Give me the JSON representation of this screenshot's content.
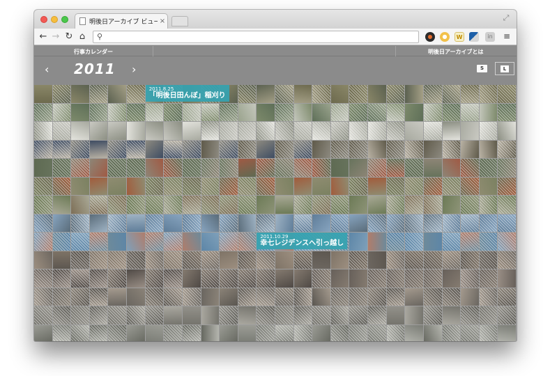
{
  "browser": {
    "tab_title": "明後日アーカイブ ビューワ",
    "tab_close": "×",
    "omnibox_value": "",
    "ext_3_label": "W",
    "ext_5_label": "in"
  },
  "site": {
    "nav_left": "行事カレンダー",
    "nav_right": "明後日アーカイブとは"
  },
  "calendar": {
    "year": "2011",
    "prev_symbol": "‹",
    "next_symbol": "›",
    "size_small": "S",
    "size_large": "L"
  },
  "events": [
    {
      "date": "2011.8.25",
      "title": "「明後日田んぼ」稲刈り"
    },
    {
      "date": "2011.10.29",
      "title": "幸七レジデンスへ引っ越し"
    }
  ],
  "mosaic": {
    "rows": 14,
    "columns": 26,
    "row_palettes": [
      [
        "#6d6a4e",
        "#8a8768",
        "#5b6150",
        "#a49f86"
      ],
      [
        "#7d8a6b",
        "#5e6f58",
        "#9aa38d",
        "#c4c7bc"
      ],
      [
        "#a8aaa0",
        "#c9c9c2",
        "#8c8f83",
        "#e3e3dd"
      ],
      [
        "#5f5a4a",
        "#8d8a80",
        "#3e4c62",
        "#b9b2a4"
      ],
      [
        "#67735c",
        "#8d8576",
        "#a05a44",
        "#5e6a52"
      ],
      [
        "#7b8161",
        "#6c6a52",
        "#a15c3c",
        "#8f8c71"
      ],
      [
        "#6c7a56",
        "#8e9478",
        "#7d6e56",
        "#a9a996"
      ],
      [
        "#5f7d99",
        "#87a4bf",
        "#5a6c7a",
        "#9fb3c4"
      ],
      [
        "#5d86a7",
        "#7fa0ba",
        "#b07d6b",
        "#6e8a9a"
      ],
      [
        "#5d5750",
        "#7e7366",
        "#9d8f80",
        "#6d6760"
      ],
      [
        "#67605a",
        "#857b70",
        "#4f4945",
        "#9a8f86"
      ],
      [
        "#6a6660",
        "#8b8378",
        "#5a5650",
        "#a49a8e"
      ],
      [
        "#75746d",
        "#93918a",
        "#5f5e58",
        "#aaa8a0"
      ],
      [
        "#7a7c75",
        "#9b9c95",
        "#666860",
        "#b4b5ae"
      ]
    ],
    "banner_positions": [
      {
        "event": 0,
        "row": 0,
        "col": 6
      },
      {
        "event": 1,
        "row": 8,
        "col": 12
      }
    ]
  }
}
